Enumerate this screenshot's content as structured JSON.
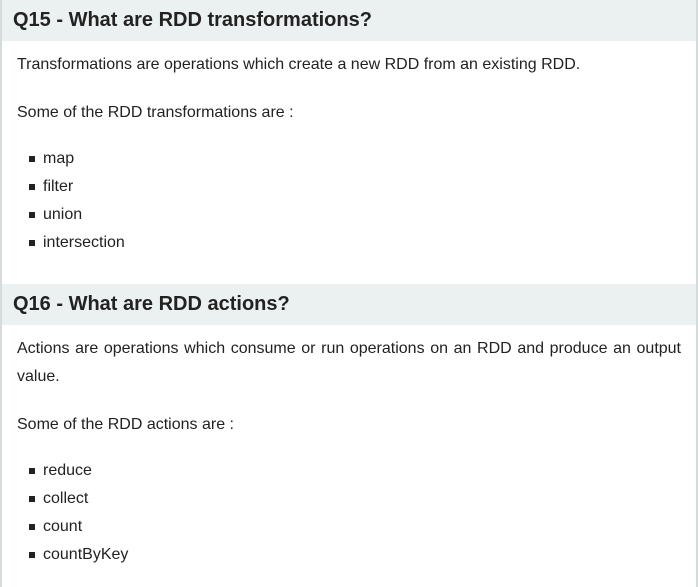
{
  "q15": {
    "title": "Q15 - What are RDD transformations?",
    "paragraph1": "Transformations are operations which create a new RDD from an existing RDD.",
    "paragraph2": "Some of the RDD transformations are :",
    "items": [
      "map",
      "filter",
      "union",
      "intersection"
    ]
  },
  "q16": {
    "title": "Q16 - What are RDD actions?",
    "paragraph1": "Actions are operations which consume or run operations on an RDD and produce an output value.",
    "paragraph2": "Some of the RDD actions are :",
    "items": [
      "reduce",
      "collect",
      "count",
      "countByKey"
    ]
  }
}
